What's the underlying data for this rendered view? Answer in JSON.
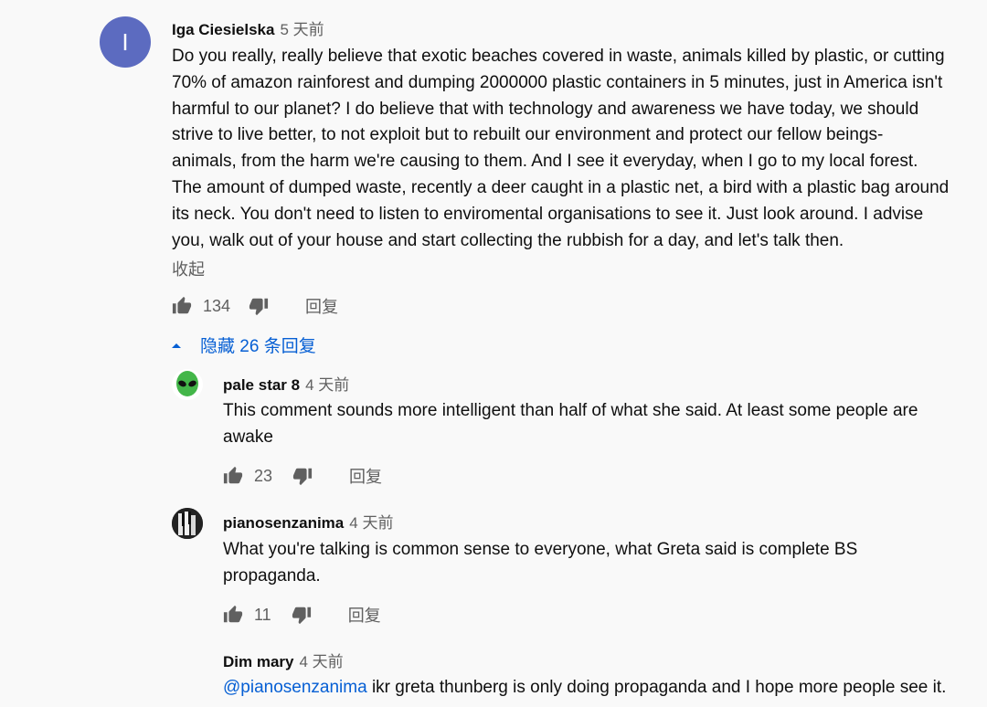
{
  "top_comment": {
    "avatar_letter": "I",
    "author": "Iga Ciesielska",
    "time": "5 天前",
    "lines": [
      "Do you really, really believe that exotic beaches covered in waste, animals killed by plastic, or cutting",
      "70% of amazon rainforest and dumping 2000000 plastic containers in 5 minutes, just in America isn't",
      "harmful to our planet?  I do believe that with technology and awareness we have today, we should",
      "strive to live better, to not exploit but to rebuilt our environment and protect our fellow beings-",
      "animals, from the harm we're causing to them. And I see it everyday, when I go to my local forest.",
      "The amount of dumped waste, recently a deer caught in a plastic net, a bird with a plastic bag around",
      "its neck. You don't need to listen to enviromental organisations to see it. Just look around. I advise",
      "you, walk out of your house and start collecting the rubbish for a day, and let's talk then."
    ],
    "collapse_label": "收起",
    "likes": "134",
    "reply_label": "回复"
  },
  "hide_replies_label": "隐藏 26 条回复",
  "replies": [
    {
      "author": "pale star 8",
      "time": "4 天前",
      "lines": [
        "This comment sounds more intelligent than half of what she said. At least some people are",
        "awake"
      ],
      "likes": "23",
      "reply_label": "回复"
    },
    {
      "author": "pianosenzanima",
      "time": "4 天前",
      "lines": [
        "What you're talking is common sense to everyone, what Greta said is complete BS",
        "propaganda."
      ],
      "likes": "11",
      "reply_label": "回复"
    },
    {
      "author": "Dim mary",
      "time": "4 天前",
      "mention": "@pianosenzanima",
      "text": " ikr greta thunberg is only doing propaganda and I hope more people see it."
    }
  ],
  "colors": {
    "avatar_bg": "#5c6bc0",
    "link": "#065fd4",
    "secondary_text": "#606060"
  },
  "icons": [
    "thumb-up-icon",
    "thumb-down-icon",
    "caret-up-icon",
    "alien-icon",
    "piano-keys-icon"
  ]
}
